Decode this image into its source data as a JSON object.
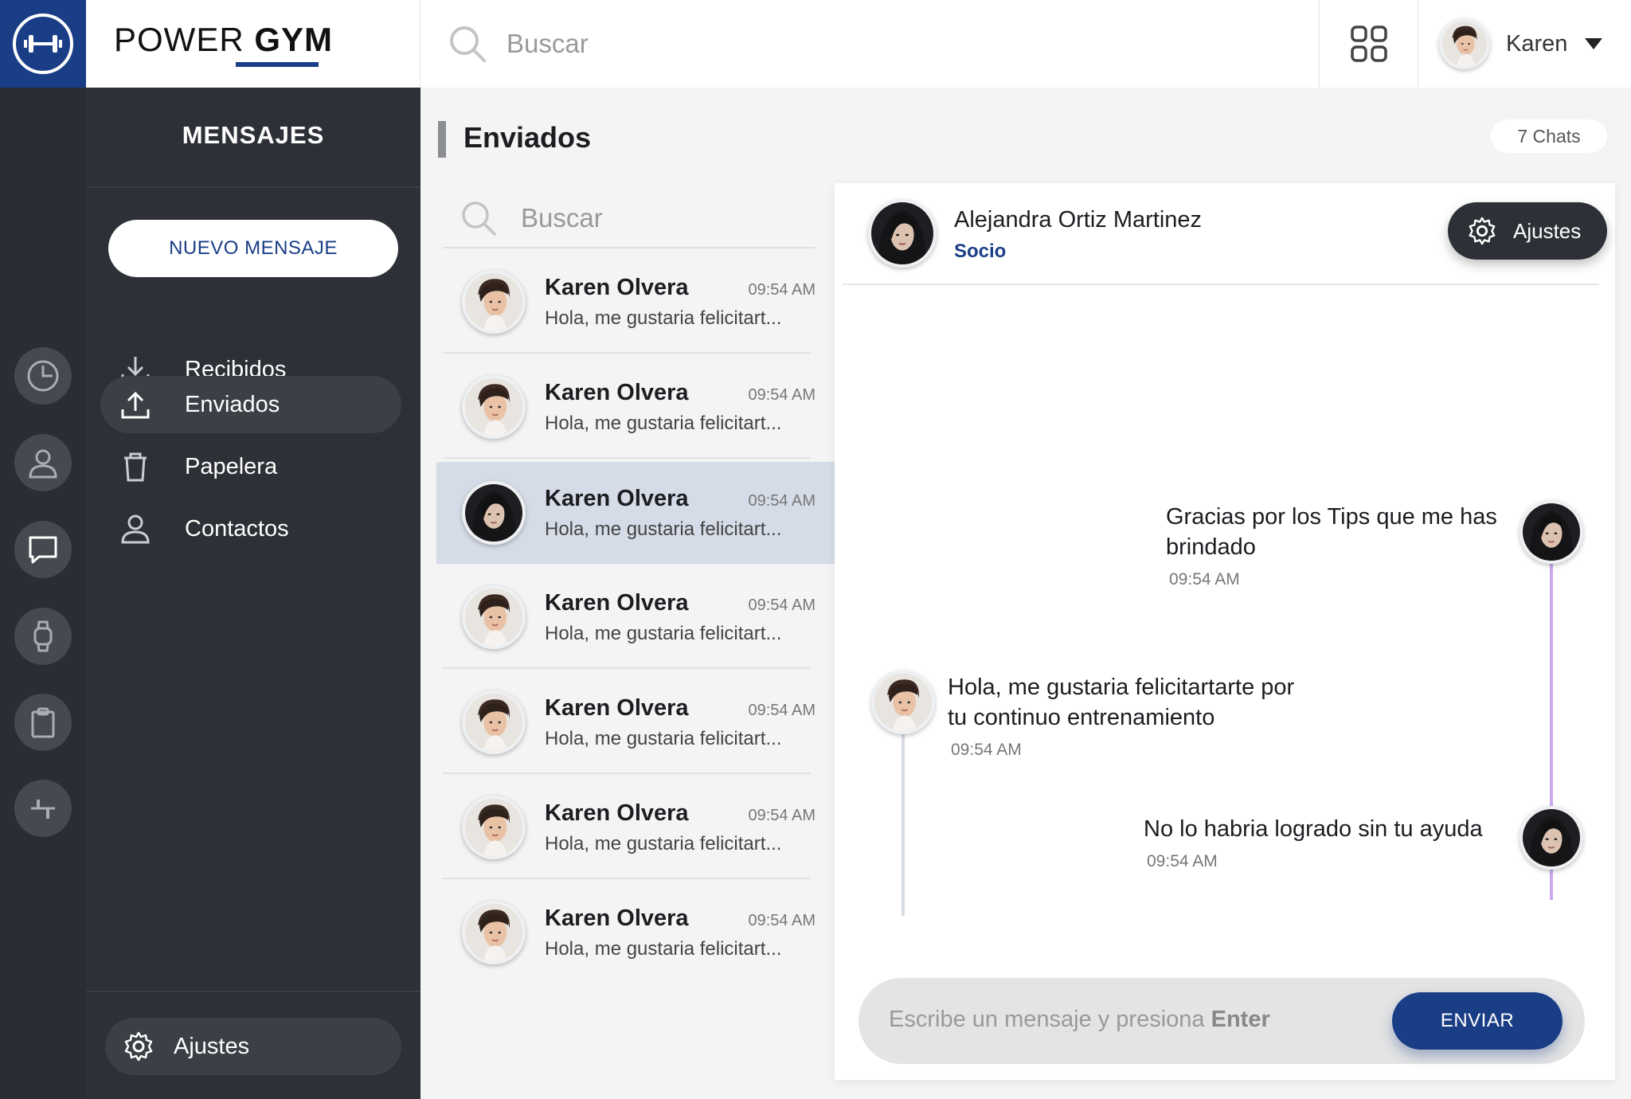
{
  "brand": {
    "prefix": "POWER",
    "suffix": "GYM"
  },
  "topbar": {
    "search_placeholder": "Buscar",
    "user_name": "Karen"
  },
  "nav": {
    "title": "MENSAJES",
    "new_message": "NUEVO MENSAJE",
    "items": [
      {
        "label": "Recibidos",
        "icon": "download-icon"
      },
      {
        "label": "Enviados",
        "icon": "upload-icon",
        "active": true
      },
      {
        "label": "Papelera",
        "icon": "trash-icon"
      },
      {
        "label": "Contactos",
        "icon": "contact-icon"
      }
    ],
    "settings": "Ajustes"
  },
  "rail": [
    "chart-icon",
    "user-icon",
    "chat-icon",
    "watch-icon",
    "clipboard-icon",
    "sliders-icon"
  ],
  "list": {
    "title": "Enviados",
    "count_badge": "7 Chats",
    "search_placeholder": "Buscar",
    "chats": [
      {
        "name": "Karen Olvera",
        "time": "09:54 AM",
        "preview": "Hola, me gustaria felicitart..."
      },
      {
        "name": "Karen Olvera",
        "time": "09:54 AM",
        "preview": "Hola, me gustaria felicitart..."
      },
      {
        "name": "Karen Olvera",
        "time": "09:54 AM",
        "preview": "Hola, me gustaria felicitart...",
        "selected": true
      },
      {
        "name": "Karen Olvera",
        "time": "09:54 AM",
        "preview": "Hola, me gustaria felicitart..."
      },
      {
        "name": "Karen Olvera",
        "time": "09:54 AM",
        "preview": "Hola, me gustaria felicitart..."
      },
      {
        "name": "Karen Olvera",
        "time": "09:54 AM",
        "preview": "Hola, me gustaria felicitart..."
      },
      {
        "name": "Karen Olvera",
        "time": "09:54 AM",
        "preview": "Hola, me gustaria felicitart..."
      }
    ]
  },
  "conversation": {
    "contact_name": "Alejandra Ortiz Martinez",
    "contact_role": "Socio",
    "settings_label": "Ajustes",
    "messages": [
      {
        "from": "contact",
        "text_line1": "Gracias por los Tips que me has",
        "text_line2": "brindado",
        "time": "09:54 AM"
      },
      {
        "from": "me",
        "text_line1": "Hola, me gustaria felicitartarte por",
        "text_line2": "tu continuo entrenamiento",
        "time": "09:54 AM"
      },
      {
        "from": "contact",
        "text_line1": "No lo habria logrado sin tu ayuda",
        "time": "09:54 AM"
      }
    ],
    "composer_placeholder": "Escribe un mensaje y presiona",
    "composer_key": "Enter",
    "send_label": "ENVIAR"
  },
  "colors": {
    "brand_blue": "#1a3e86",
    "sidebar_dark": "#2d3036",
    "rail_dark": "#2a2d33",
    "selected_row": "#d5dce7",
    "thread_purple": "#c9a9ee"
  }
}
